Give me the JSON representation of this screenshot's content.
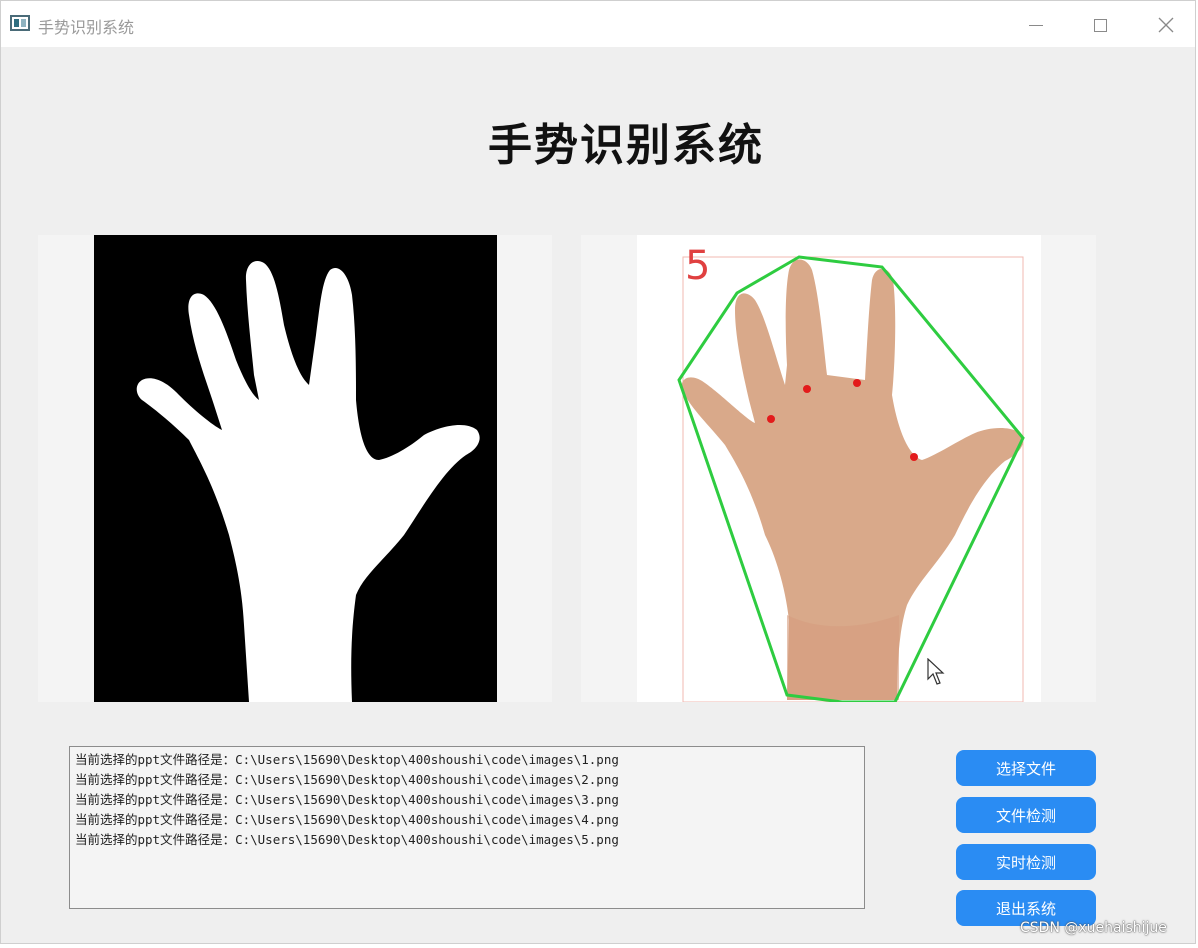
{
  "window": {
    "title": "手势识别系统",
    "controls": [
      "minimize-icon",
      "maximize-icon",
      "close-icon"
    ]
  },
  "heading": "手势识别系统",
  "images": {
    "left": {
      "content": "binary hand mask (white hand on black)"
    },
    "right": {
      "content": "hand photo with convex hull",
      "finger_count_label": "5",
      "hull_color": "#2ecc40",
      "defect_point_color": "#e31b1b"
    }
  },
  "log": {
    "lines": [
      "当前选择的ppt文件路径是：C:\\Users\\15690\\Desktop\\400shoushi\\code\\images\\1.png",
      "当前选择的ppt文件路径是：C:\\Users\\15690\\Desktop\\400shoushi\\code\\images\\2.png",
      "当前选择的ppt文件路径是：C:\\Users\\15690\\Desktop\\400shoushi\\code\\images\\3.png",
      "当前选择的ppt文件路径是：C:\\Users\\15690\\Desktop\\400shoushi\\code\\images\\4.png",
      "当前选择的ppt文件路径是：C:\\Users\\15690\\Desktop\\400shoushi\\code\\images\\5.png"
    ]
  },
  "buttons": {
    "select_file": "选择文件",
    "file_detect": "文件检测",
    "realtime_detect": "实时检测",
    "exit_system": "退出系统"
  },
  "colors": {
    "button_bg": "#2a8cf3",
    "window_bg": "#efefef"
  },
  "watermark": "CSDN @xuehaishijue"
}
